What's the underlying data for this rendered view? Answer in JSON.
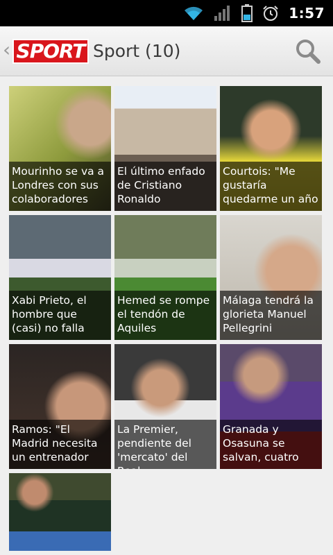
{
  "status": {
    "time": "1:57"
  },
  "actionbar": {
    "logo_text": "SPORT",
    "title": "Sport (10)"
  },
  "icons": {
    "back": "back-caret-icon",
    "search": "search-icon",
    "wifi": "wifi-icon",
    "signal": "signal-icon",
    "battery": "battery-icon",
    "alarm": "alarm-icon"
  },
  "colors": {
    "brand_red": "#d9161c",
    "status_teal": "#33b5e5"
  },
  "articles": [
    {
      "caption": "Mourinho se va a Londres con sus colaboradores"
    },
    {
      "caption": "El último enfado de Cristiano Ronaldo"
    },
    {
      "caption": "Courtois: \"Me gustaría quedarme un año"
    },
    {
      "caption": "Xabi Prieto, el hombre que (casi) no falla"
    },
    {
      "caption": "Hemed se rompe el tendón de Aquiles"
    },
    {
      "caption": "Málaga tendrá la glorieta Manuel Pellegrini"
    },
    {
      "caption": "Ramos: \"El Madrid necesita un entrenador"
    },
    {
      "caption": "La Premier, pendiente del 'mercato' del Real"
    },
    {
      "caption": "Granada y Osasuna se salvan, cuatro"
    },
    {
      "caption": ""
    }
  ]
}
